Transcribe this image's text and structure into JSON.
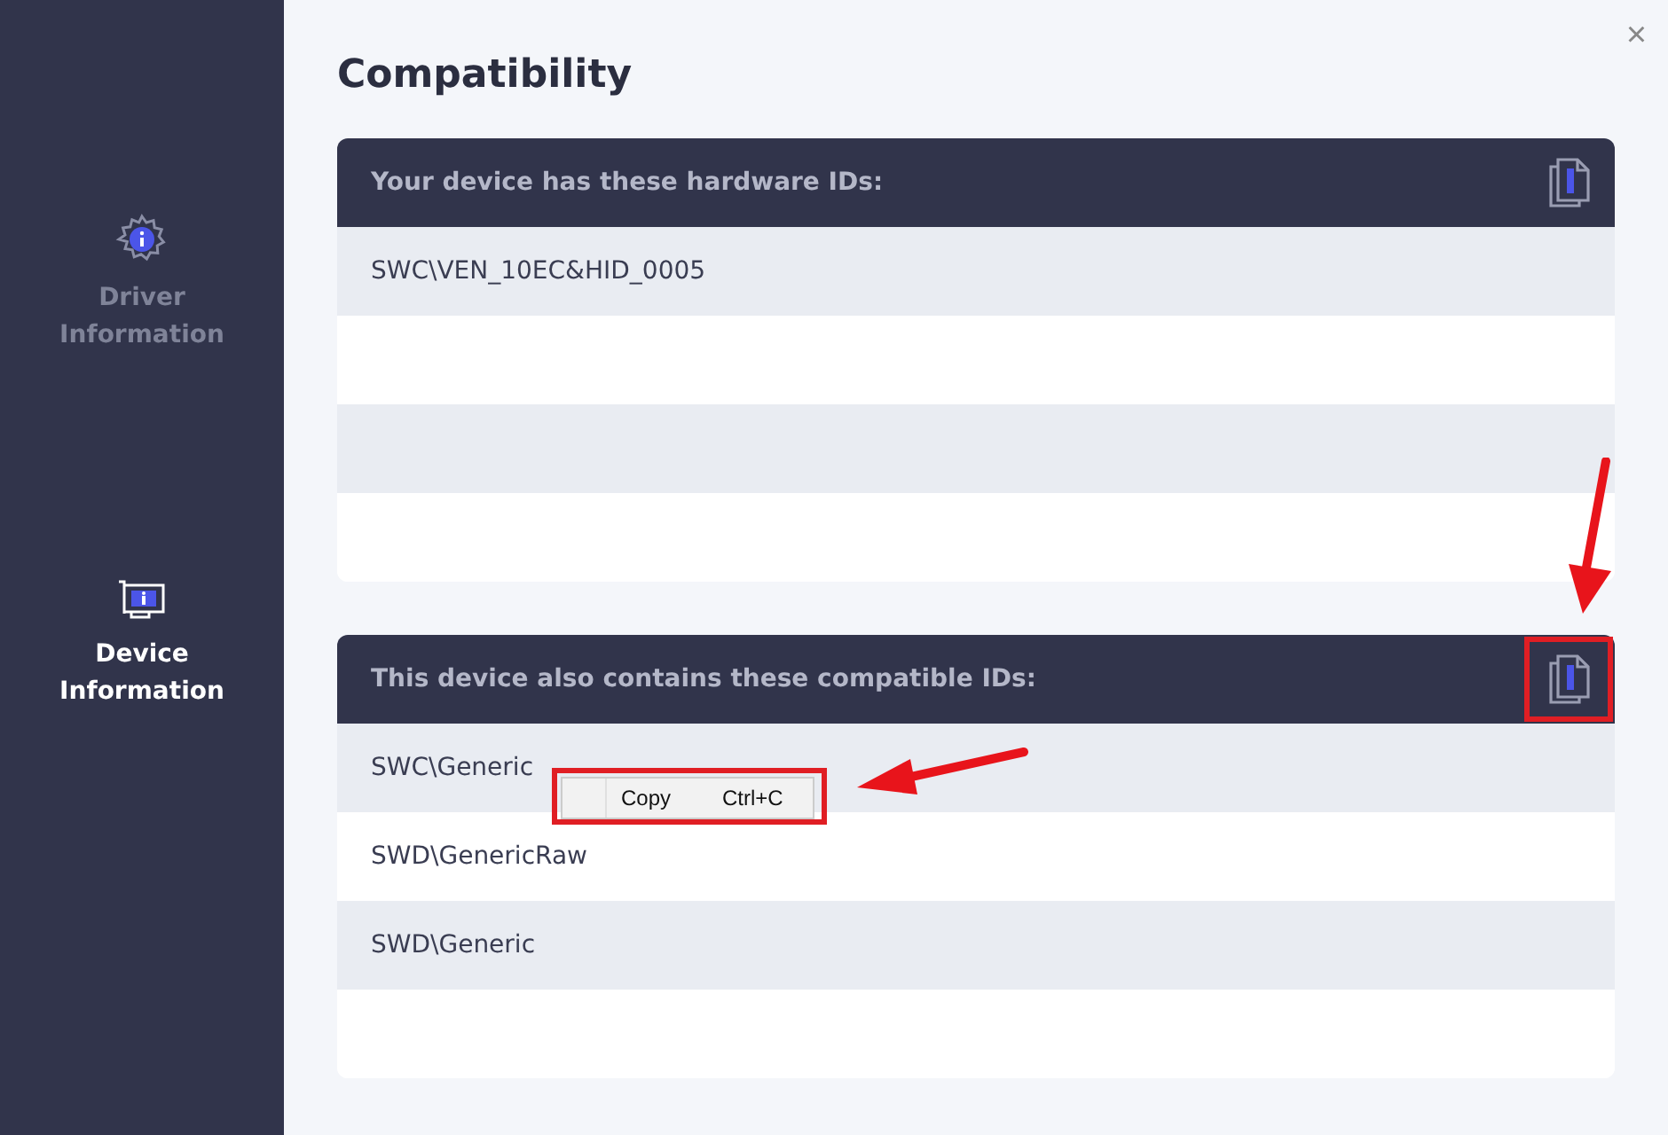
{
  "sidebar": {
    "items": [
      {
        "label": "Driver Information",
        "kind": "driver",
        "selected": false
      },
      {
        "label": "Device Information",
        "kind": "device",
        "selected": true
      }
    ]
  },
  "close": "×",
  "title": "Compatibility",
  "sections": [
    {
      "heading": "Your device has these hardware IDs:",
      "ids": [
        "SWC\\VEN_10EC&HID_0005"
      ]
    },
    {
      "heading": "This device also contains these compatible IDs:",
      "ids": [
        "SWC\\Generic",
        "SWD\\GenericRaw",
        "SWD\\Generic"
      ]
    }
  ],
  "context_menu": {
    "item": "Copy",
    "shortcut": "Ctrl+C"
  }
}
